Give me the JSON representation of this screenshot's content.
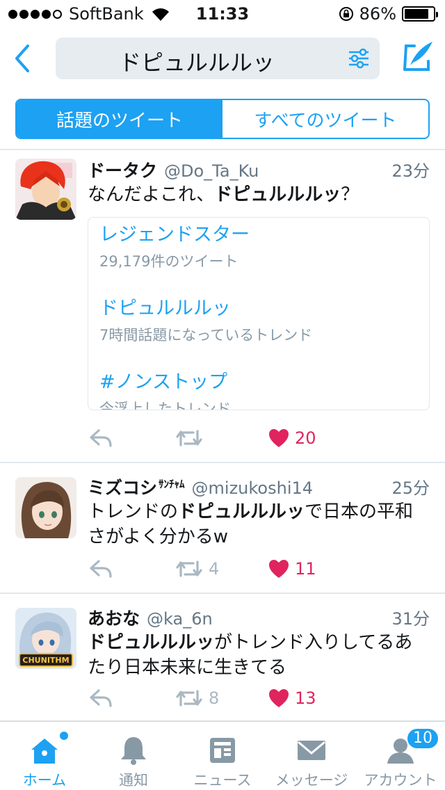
{
  "status_bar": {
    "carrier": "SoftBank",
    "time": "11:33",
    "battery_percent": "86%",
    "battery_level": 0.86,
    "signal_bars": 4
  },
  "header": {
    "search_query": "ドピュルルルッ",
    "back_icon": "chevron-left-icon",
    "filter_icon": "sliders-icon",
    "compose_icon": "compose-feather-icon"
  },
  "segments": {
    "top": "話題のツイート",
    "all": "すべてのツイート",
    "active": "top"
  },
  "tweets": [
    {
      "name": "ドータク",
      "handle": "@Do_Ta_Ku",
      "time": "23分",
      "text_before": "なんだよこれ、",
      "text_bold": "ドピュルルルッ",
      "text_after": "？",
      "retweets": "",
      "likes": "20",
      "card": [
        {
          "title": "レジェンドスター",
          "sub": "29,179件のツイート"
        },
        {
          "title": "ドピュルルルッ",
          "sub": "7時間話題になっているトレンド"
        },
        {
          "title": "#ノンストップ",
          "sub": "今浮上したトレンド"
        }
      ]
    },
    {
      "name": "ミズコシ",
      "name_suffix": "ｻﾝﾁｬﾑ",
      "handle": "@mizukoshi14",
      "time": "25分",
      "text_before": "トレンドの",
      "text_bold": "ドピュルルルッ",
      "text_after": "で日本の平和さがよく分かるw",
      "retweets": "4",
      "likes": "11"
    },
    {
      "name": "あおな",
      "handle": "@ka_6n",
      "time": "31分",
      "text_before": "",
      "text_bold": "ドピュルルルッ",
      "text_after": "がトレンド入りしてるあたり日本未来に生きてる",
      "retweets": "8",
      "likes": "13"
    }
  ],
  "tabbar": {
    "home": "ホーム",
    "notifications": "通知",
    "news": "ニュース",
    "messages": "メッセージ",
    "account": "アカウント",
    "account_badge": "10"
  },
  "colors": {
    "accent": "#1da1f2",
    "like": "#e0245e",
    "muted": "#aab8c2"
  }
}
